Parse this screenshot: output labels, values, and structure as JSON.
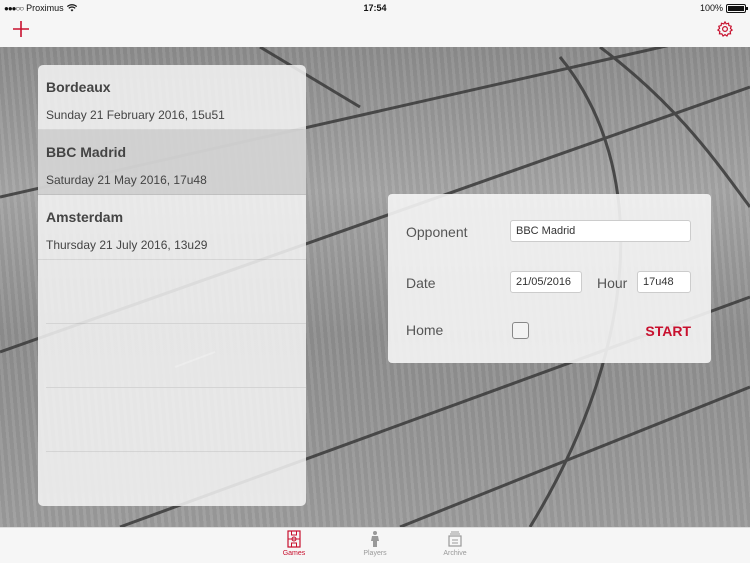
{
  "status_bar": {
    "carrier": "Proximus",
    "time": "17:54",
    "battery": "100%"
  },
  "navbar": {
    "add_icon": "plus-icon",
    "settings_icon": "gear-icon",
    "accent_color": "#c8102e"
  },
  "games": [
    {
      "opponent": "Bordeaux",
      "date": "Sunday 21 February 2016, 15u51",
      "selected": false
    },
    {
      "opponent": "BBC Madrid",
      "date": "Saturday 21 May 2016, 17u48",
      "selected": true
    },
    {
      "opponent": "Amsterdam",
      "date": "Thursday 21 July 2016, 13u29",
      "selected": false
    }
  ],
  "form": {
    "opponent_label": "Opponent",
    "opponent_value": "BBC Madrid",
    "date_label": "Date",
    "date_value": "21/05/2016",
    "hour_label": "Hour",
    "hour_value": "17u48",
    "home_label": "Home",
    "home_checked": false,
    "start_label": "START"
  },
  "tabs": [
    {
      "label": "Games",
      "icon": "court-icon",
      "active": true
    },
    {
      "label": "Players",
      "icon": "player-icon",
      "active": false
    },
    {
      "label": "Archive",
      "icon": "archive-icon",
      "active": false
    }
  ]
}
